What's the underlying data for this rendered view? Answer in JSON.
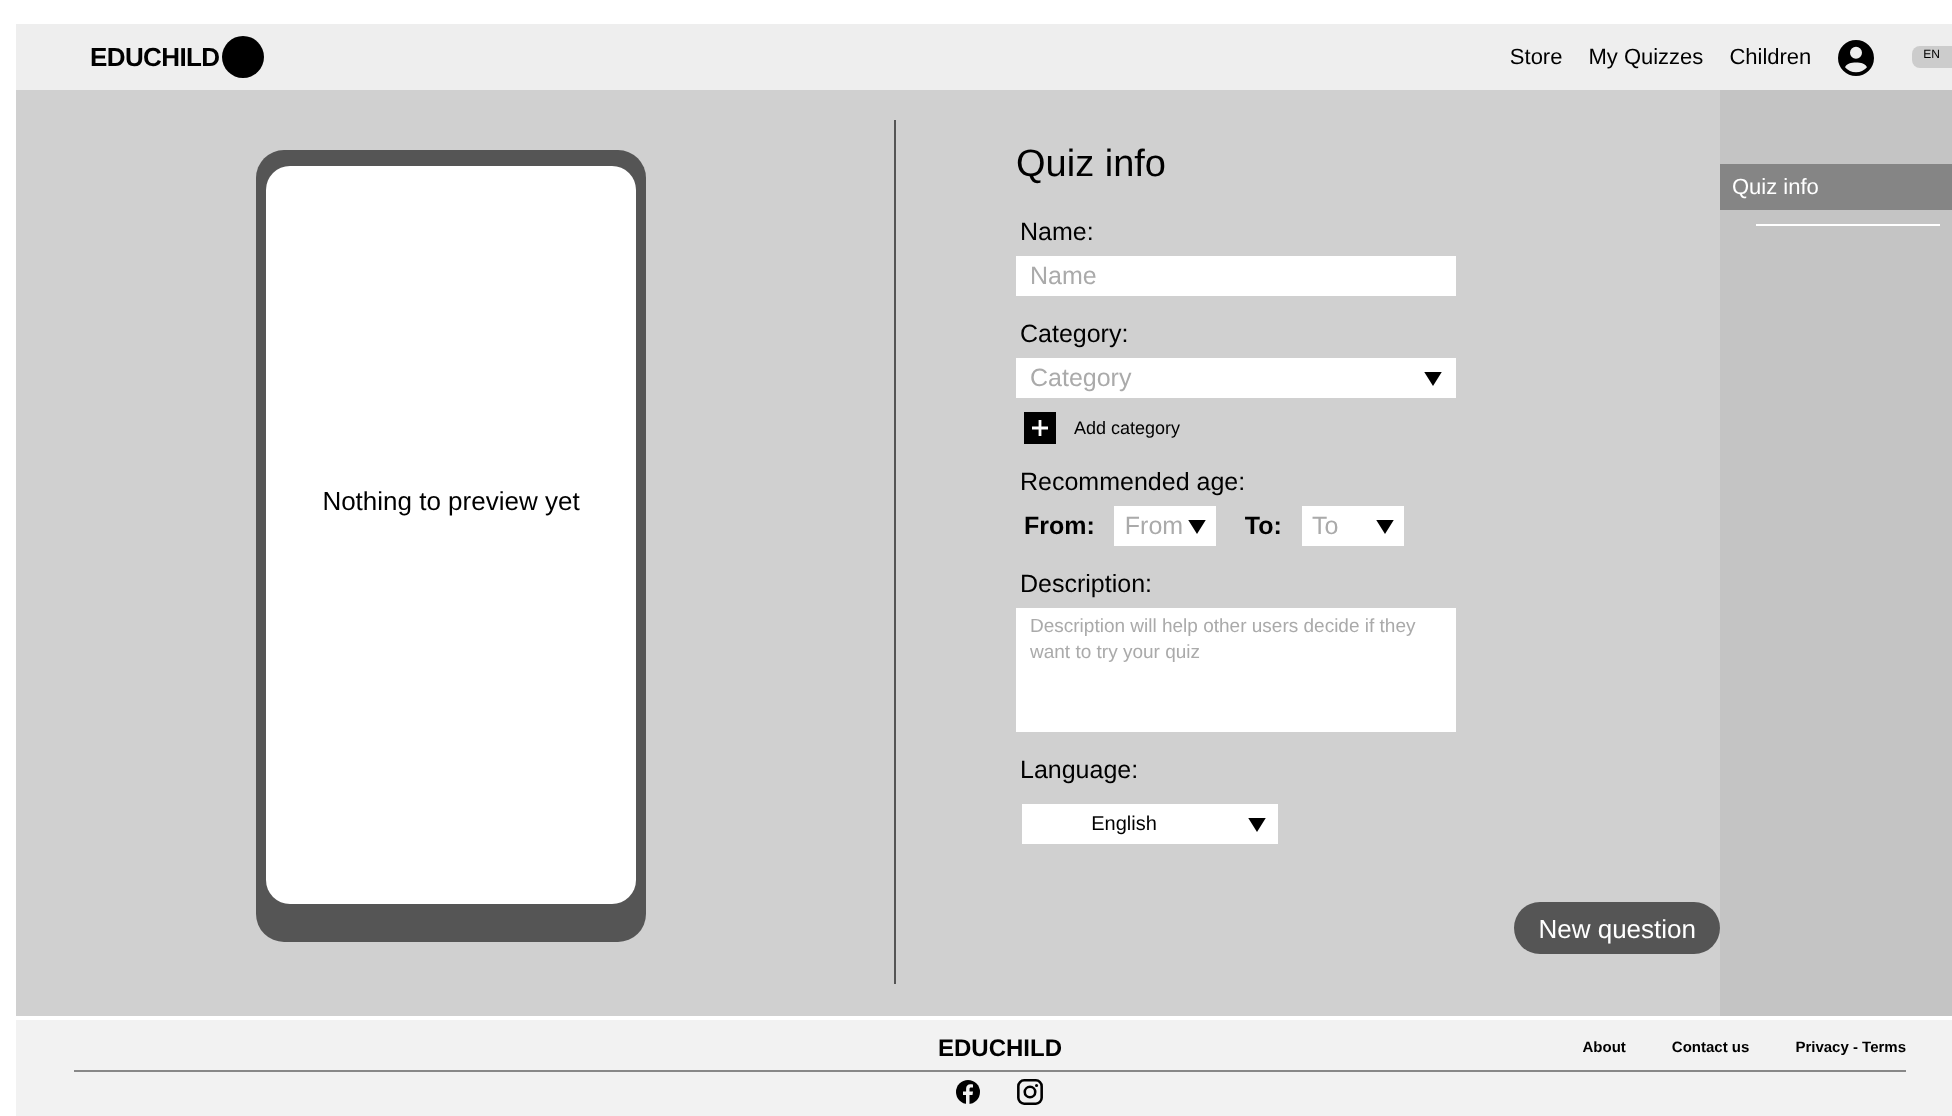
{
  "header": {
    "logo": "EDUCHILD",
    "nav": [
      "Store",
      "My Quizzes",
      "Children"
    ],
    "language": "EN"
  },
  "preview": {
    "message": "Nothing to preview yet"
  },
  "form": {
    "title": "Quiz info",
    "fields": [
      {
        "kind": "text",
        "label": "Name:",
        "placeholder": "Name"
      },
      {
        "kind": "select",
        "label": "Category:",
        "placeholder": "Category",
        "action": "Add category"
      },
      {
        "kind": "range",
        "label": "Recommended age:",
        "from_label": "From:",
        "from_placeholder": "From",
        "to_label": "To:",
        "to_placeholder": "To"
      },
      {
        "kind": "textarea",
        "label": "Description:",
        "placeholder": "Description will help other users decide if they want to try your quiz"
      },
      {
        "kind": "value-select",
        "label": "Language:",
        "value": "English"
      }
    ],
    "button": "New question"
  },
  "sidebar": {
    "items": [
      {
        "label": "Quiz info",
        "selected": true
      }
    ]
  },
  "footer": {
    "brand": "EDUCHILD",
    "links": [
      "About",
      "Contact us",
      "Privacy - Terms"
    ]
  }
}
